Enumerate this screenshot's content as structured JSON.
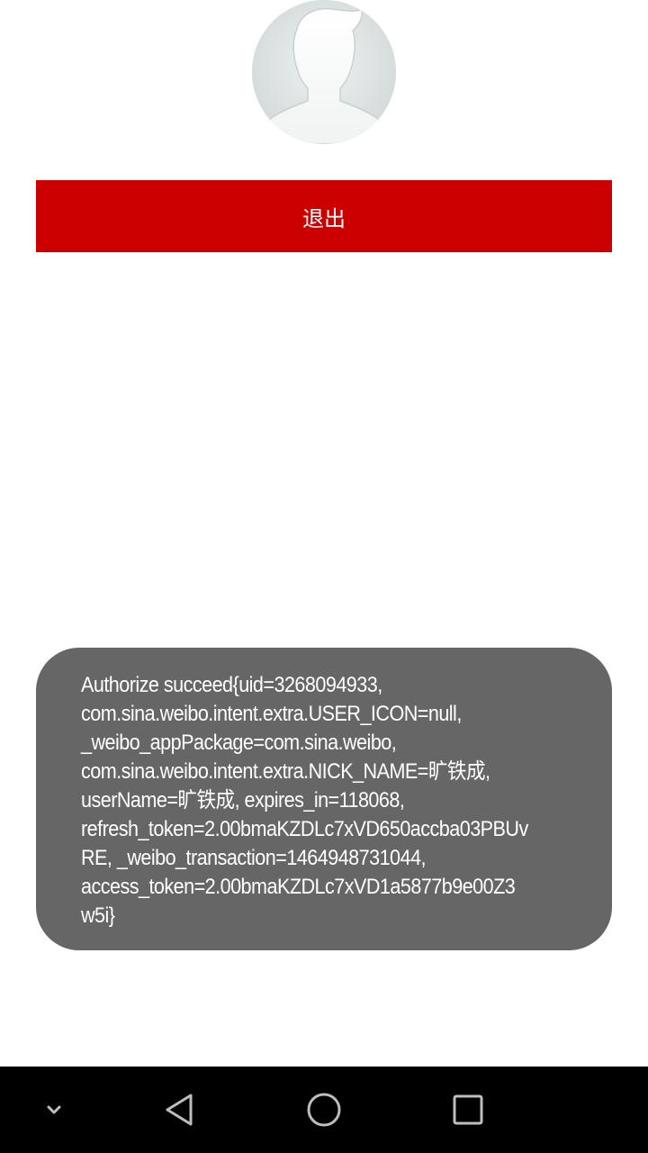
{
  "profile": {
    "avatar_icon": "default-user-avatar-icon"
  },
  "actions": {
    "logout_label": "退出"
  },
  "toast": {
    "lines": [
      "Authorize succeed{uid=3268094933,",
      "com.sina.weibo.intent.extra.USER_ICON=null,",
      "_weibo_appPackage=com.sina.weibo,",
      "com.sina.weibo.intent.extra.NICK_NAME=旷铁成,",
      "userName=旷铁成, expires_in=118068,",
      "refresh_token=2.00bmaKZDLc7xVD650accba03PBUv",
      "RE, _weibo_transaction=1464948731044,",
      "access_token=2.00bmaKZDLc7xVD1a5877b9e00Z3",
      "w5i}"
    ]
  },
  "navbar": {
    "icons": [
      "chevron-down-icon",
      "back-triangle-icon",
      "home-circle-icon",
      "recents-square-icon"
    ]
  },
  "colors": {
    "logout_button": "#cc0000",
    "toast_background": "#666666",
    "navbar_background": "#000000"
  }
}
